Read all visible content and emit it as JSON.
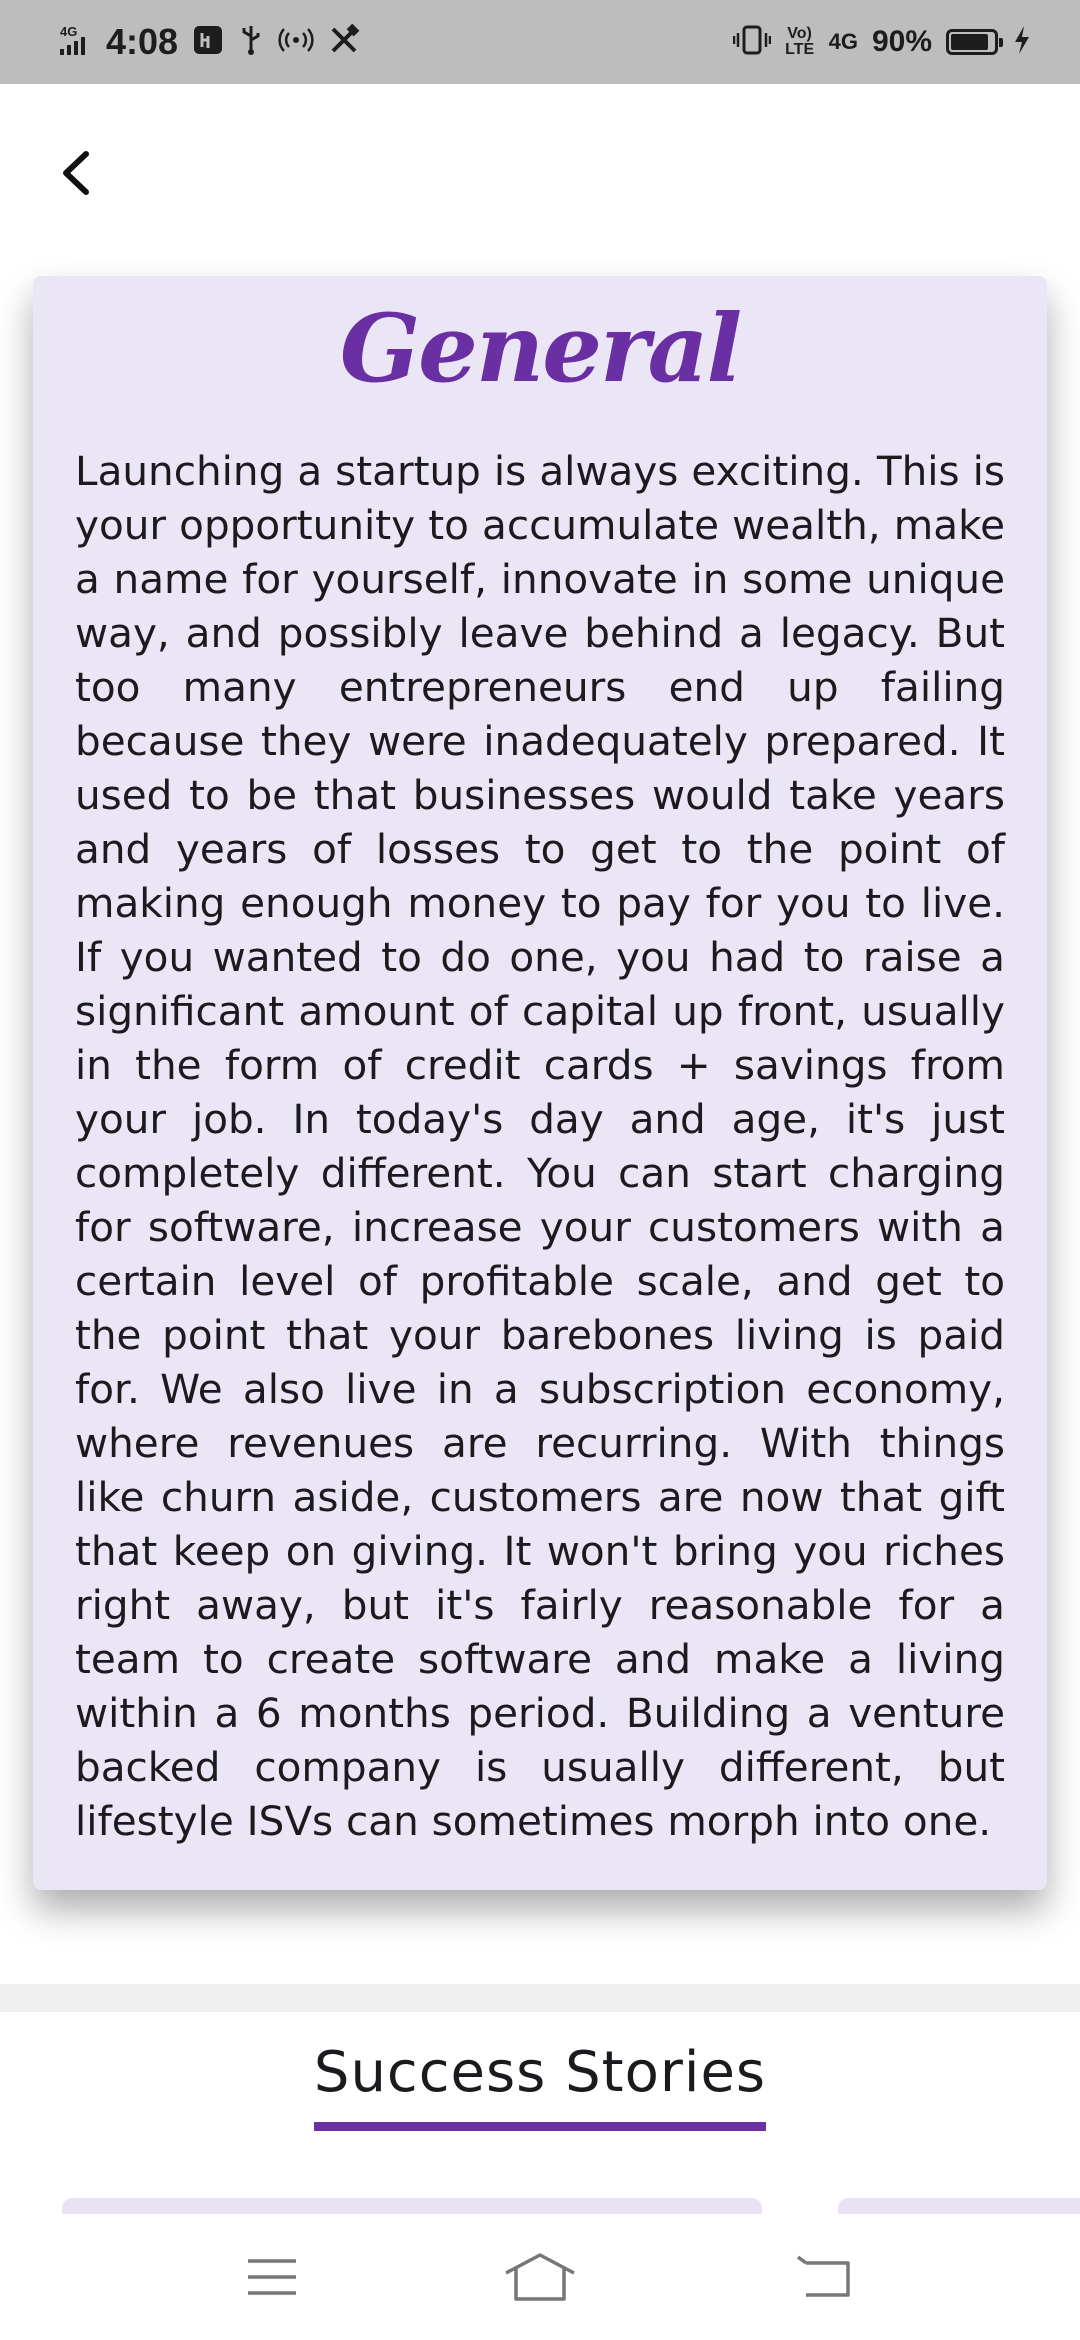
{
  "status_bar": {
    "network_left": "4G",
    "time": "4:08",
    "volte_label": "Vo) LTE",
    "network_right": "4G",
    "battery_percent_text": "90%",
    "battery_level": 0.9
  },
  "header": {
    "back_icon": "chevron-left-icon"
  },
  "card": {
    "title": "General",
    "body": "Launching a startup is always exciting. This is your opportunity to accumulate wealth, make a name for yourself, innovate in some unique way, and possibly leave behind a legacy. But too many entrepreneurs end up failing because they were inadequately prepared. It used to be that businesses would take years and years of losses to get to the point of making enough money to pay for you to live. If you wanted to do one, you had to raise a significant amount of capital up front, usually in the form of credit cards + savings from your job. In today's day and age, it's just completely different. You can start charging for software, increase your customers with a certain level of profitable scale, and get to the point that your barebones living is paid for. We also live in a subscription economy, where revenues are recurring. With things like churn aside, customers are now that gift that keep on giving. It won't bring you riches right away, but it's fairly reasonable for a team to create software and make a living within a 6 months period. Building a venture backed company is usually different, but lifestyle ISVs can sometimes morph into one."
  },
  "success_stories": {
    "title": "Success Stories"
  },
  "nav_bar": {
    "menu_icon": "menu-icon",
    "home_icon": "home-icon",
    "back_icon": "back-icon"
  },
  "colors": {
    "accent": "#6a2fa3",
    "card_background": "#ebe6f5",
    "status_bar": "#bdbdbd"
  }
}
